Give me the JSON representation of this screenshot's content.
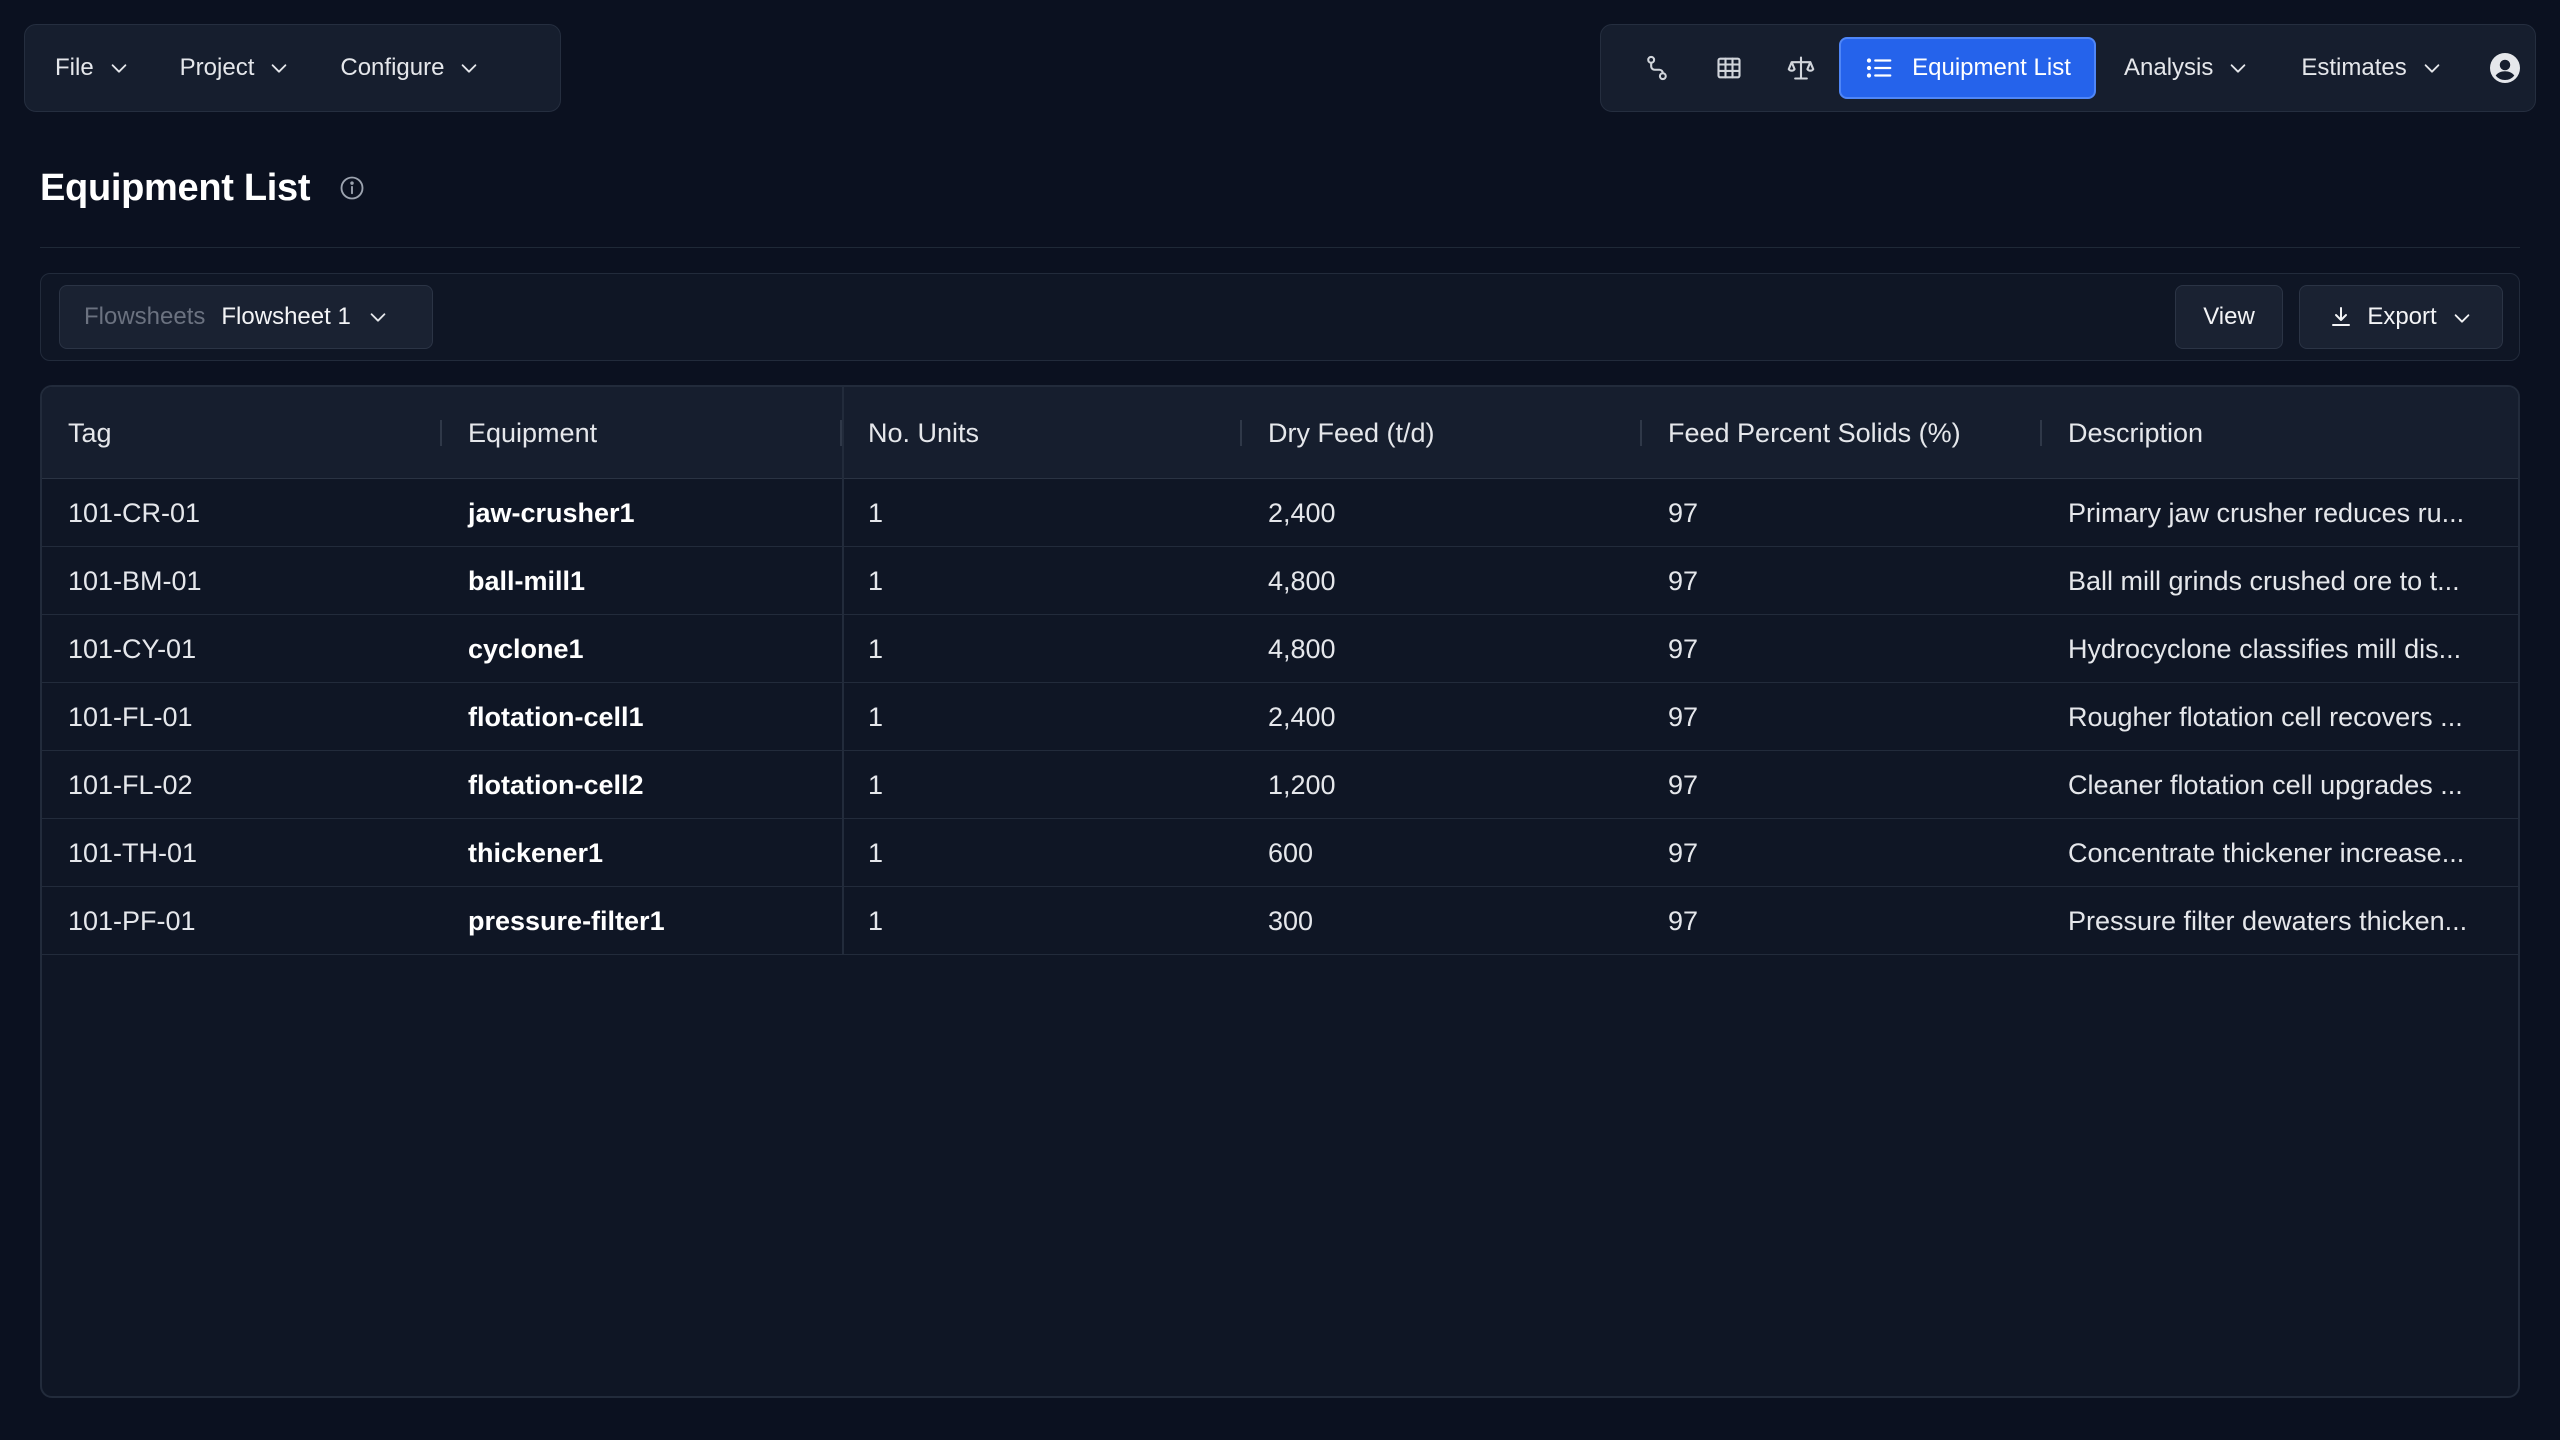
{
  "menu": {
    "items": [
      {
        "label": "File"
      },
      {
        "label": "Project"
      },
      {
        "label": "Configure"
      }
    ]
  },
  "nav": {
    "icons": [
      "flow-icon",
      "table-icon",
      "balance-icon"
    ],
    "active": {
      "label": "Equipment List",
      "icon": "list-icon"
    },
    "dropdowns": [
      {
        "label": "Analysis"
      },
      {
        "label": "Estimates"
      }
    ],
    "avatar_icon": "user-circle-icon"
  },
  "page": {
    "title": "Equipment List",
    "info_icon": "info-icon"
  },
  "toolbar": {
    "flowsheet_label": "Flowsheets",
    "flowsheet_value": "Flowsheet 1",
    "view_label": "View",
    "export_label": "Export"
  },
  "table": {
    "columns": [
      "Tag",
      "Equipment",
      "No. Units",
      "Dry Feed (t/d)",
      "Feed Percent Solids (%)",
      "Description"
    ],
    "rows": [
      {
        "tag": "101-CR-01",
        "equipment": "jaw-crusher1",
        "units": "1",
        "dry_feed": "2,400",
        "solids": "97",
        "description": "Primary jaw crusher reduces ru..."
      },
      {
        "tag": "101-BM-01",
        "equipment": "ball-mill1",
        "units": "1",
        "dry_feed": "4,800",
        "solids": "97",
        "description": "Ball mill grinds crushed ore to t..."
      },
      {
        "tag": "101-CY-01",
        "equipment": "cyclone1",
        "units": "1",
        "dry_feed": "4,800",
        "solids": "97",
        "description": "Hydrocyclone classifies mill dis..."
      },
      {
        "tag": "101-FL-01",
        "equipment": "flotation-cell1",
        "units": "1",
        "dry_feed": "2,400",
        "solids": "97",
        "description": "Rougher flotation cell recovers ..."
      },
      {
        "tag": "101-FL-02",
        "equipment": "flotation-cell2",
        "units": "1",
        "dry_feed": "1,200",
        "solids": "97",
        "description": "Cleaner flotation cell upgrades ..."
      },
      {
        "tag": "101-TH-01",
        "equipment": "thickener1",
        "units": "1",
        "dry_feed": "600",
        "solids": "97",
        "description": "Concentrate thickener increase..."
      },
      {
        "tag": "101-PF-01",
        "equipment": "pressure-filter1",
        "units": "1",
        "dry_feed": "300",
        "solids": "97",
        "description": "Pressure filter dewaters thicken..."
      }
    ]
  },
  "colors": {
    "background": "#0b1120",
    "accent": "#2563eb"
  }
}
